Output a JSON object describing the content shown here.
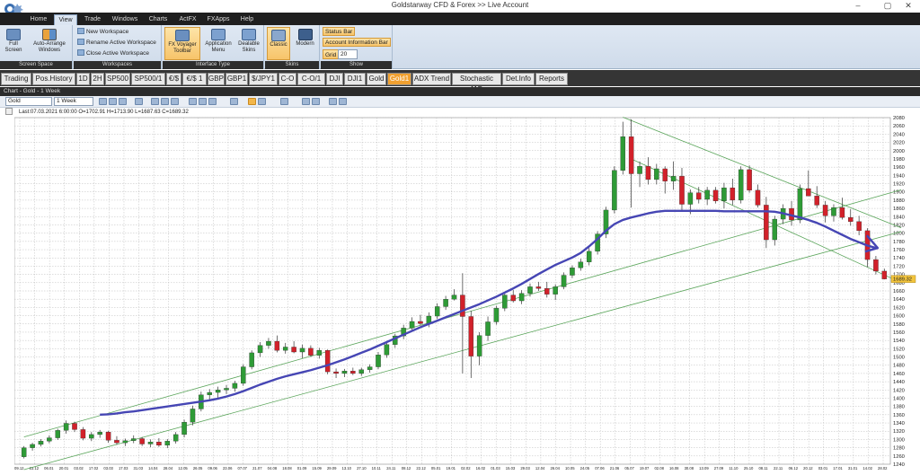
{
  "window": {
    "title": "Goldstarway CFD & Forex  >>  Live Account",
    "min": "–",
    "max": "▢",
    "close": "✕"
  },
  "menu": [
    "Home",
    "View",
    "Trade",
    "Windows",
    "Charts",
    "ActFX",
    "FXApps",
    "Help"
  ],
  "ribbon": {
    "screen_space": {
      "label": "Screen Space",
      "full_screen": "Full Screen",
      "auto_arrange": "Auto-Arrange Windows"
    },
    "workspaces": {
      "label": "Workspaces",
      "new": "New Workspace",
      "rename": "Rename Active Workspace",
      "close": "Close Active Workspace"
    },
    "interface_type": {
      "label": "Interface Type",
      "fxv": "FX Voyager Toolbar",
      "app_menu": "Application Menu",
      "dealable": "Dealable Skins"
    },
    "skins": {
      "label": "Skins",
      "classic": "Classic",
      "modern": "Modern"
    },
    "show": {
      "label": "Show",
      "status_bar": "Status Bar",
      "account_info": "Account Information Bar",
      "grid_label": "Grid",
      "grid_value": "20"
    }
  },
  "symbol_tabs": [
    "Trading",
    "Pos.History",
    "1D",
    "2H",
    "SP500",
    "SP500/1",
    "€/$",
    "€/$ 1",
    "GBP",
    "GBP1",
    "$/JPY1",
    "C-O",
    "C-O/1",
    "DJI",
    "DJI1",
    "Gold",
    "Gold1",
    "ADX Trend",
    "Stochastic 11D",
    "Det.Info",
    "Reports"
  ],
  "active_symbol_tab": "Gold1",
  "chart_window": {
    "title": "Chart - Gold - 1 Week",
    "instrument": "Gold",
    "timeframe": "1 Week",
    "ohlc": "Last:07.03.2021 6:00:00 O=1702.91 H=1713.90 L=1687.63 C=1689.32",
    "price_label": "1689.32"
  },
  "chart_data": {
    "type": "candlestick",
    "ylim": [
      1240,
      2080
    ],
    "y_ticks": [
      2080,
      2060,
      2040,
      2020,
      2000,
      1980,
      1960,
      1940,
      1920,
      1900,
      1880,
      1860,
      1840,
      1820,
      1800,
      1780,
      1760,
      1740,
      1720,
      1700,
      1680,
      1660,
      1640,
      1620,
      1600,
      1580,
      1560,
      1540,
      1520,
      1500,
      1480,
      1460,
      1440,
      1420,
      1400,
      1380,
      1360,
      1340,
      1320,
      1300,
      1280,
      1260,
      1240
    ],
    "x_labels": [
      "09.12",
      "23.12",
      "06.01",
      "20.01",
      "03.02",
      "17.02",
      "03.03",
      "17.03",
      "31.03",
      "14.04",
      "28.04",
      "12.05",
      "26.05",
      "09.06",
      "23.06",
      "07.07",
      "21.07",
      "04.08",
      "18.08",
      "01.09",
      "15.09",
      "29.09",
      "13.10",
      "27.10",
      "10.11",
      "24.11",
      "08.12",
      "22.12",
      "05.01",
      "19.01",
      "02.02",
      "16.02",
      "01.03",
      "15.03",
      "29.03",
      "12.04",
      "26.04",
      "10.05",
      "24.05",
      "07.06",
      "21.06",
      "05.07",
      "19.07",
      "02.08",
      "16.08",
      "30.08",
      "13.09",
      "27.09",
      "11.10",
      "25.10",
      "08.11",
      "22.11",
      "06.12",
      "20.12",
      "03.01",
      "17.01",
      "31.01",
      "14.02",
      "28.02"
    ],
    "candles": [
      [
        1258,
        1284,
        1254,
        1280
      ],
      [
        1280,
        1292,
        1273,
        1288
      ],
      [
        1288,
        1301,
        1283,
        1296
      ],
      [
        1296,
        1310,
        1291,
        1304
      ],
      [
        1304,
        1326,
        1299,
        1322
      ],
      [
        1322,
        1346,
        1314,
        1339
      ],
      [
        1339,
        1343,
        1318,
        1324
      ],
      [
        1324,
        1330,
        1298,
        1303
      ],
      [
        1303,
        1318,
        1296,
        1312
      ],
      [
        1312,
        1323,
        1304,
        1318
      ],
      [
        1318,
        1321,
        1292,
        1298
      ],
      [
        1298,
        1308,
        1287,
        1292
      ],
      [
        1292,
        1302,
        1284,
        1297
      ],
      [
        1297,
        1310,
        1291,
        1302
      ],
      [
        1302,
        1306,
        1284,
        1289
      ],
      [
        1289,
        1300,
        1281,
        1294
      ],
      [
        1294,
        1303,
        1282,
        1286
      ],
      [
        1286,
        1301,
        1279,
        1296
      ],
      [
        1296,
        1318,
        1290,
        1312
      ],
      [
        1312,
        1348,
        1305,
        1342
      ],
      [
        1342,
        1382,
        1334,
        1374
      ],
      [
        1374,
        1416,
        1368,
        1408
      ],
      [
        1408,
        1422,
        1396,
        1414
      ],
      [
        1414,
        1428,
        1401,
        1420
      ],
      [
        1420,
        1432,
        1410,
        1424
      ],
      [
        1424,
        1442,
        1416,
        1436
      ],
      [
        1436,
        1482,
        1430,
        1476
      ],
      [
        1476,
        1516,
        1470,
        1510
      ],
      [
        1510,
        1536,
        1500,
        1528
      ],
      [
        1528,
        1546,
        1520,
        1538
      ],
      [
        1538,
        1552,
        1511,
        1516
      ],
      [
        1516,
        1534,
        1508,
        1524
      ],
      [
        1524,
        1538,
        1509,
        1512
      ],
      [
        1512,
        1530,
        1497,
        1521
      ],
      [
        1521,
        1528,
        1500,
        1504
      ],
      [
        1504,
        1522,
        1496,
        1516
      ],
      [
        1516,
        1518,
        1458,
        1464
      ],
      [
        1464,
        1472,
        1449,
        1460
      ],
      [
        1460,
        1471,
        1451,
        1466
      ],
      [
        1466,
        1474,
        1456,
        1460
      ],
      [
        1460,
        1474,
        1454,
        1469
      ],
      [
        1469,
        1482,
        1462,
        1476
      ],
      [
        1476,
        1512,
        1470,
        1505
      ],
      [
        1505,
        1538,
        1498,
        1530
      ],
      [
        1530,
        1556,
        1522,
        1551
      ],
      [
        1551,
        1578,
        1543,
        1570
      ],
      [
        1570,
        1596,
        1563,
        1586
      ],
      [
        1586,
        1602,
        1577,
        1581
      ],
      [
        1581,
        1608,
        1572,
        1599
      ],
      [
        1599,
        1630,
        1592,
        1622
      ],
      [
        1622,
        1648,
        1614,
        1640
      ],
      [
        1640,
        1664,
        1637,
        1650
      ],
      [
        1650,
        1703,
        1460,
        1598
      ],
      [
        1598,
        1612,
        1449,
        1502
      ],
      [
        1502,
        1560,
        1480,
        1552
      ],
      [
        1552,
        1598,
        1539,
        1585
      ],
      [
        1585,
        1624,
        1578,
        1618
      ],
      [
        1618,
        1656,
        1611,
        1650
      ],
      [
        1650,
        1662,
        1632,
        1636
      ],
      [
        1636,
        1662,
        1628,
        1654
      ],
      [
        1654,
        1678,
        1646,
        1670
      ],
      [
        1670,
        1682,
        1660,
        1666
      ],
      [
        1666,
        1682,
        1644,
        1652
      ],
      [
        1652,
        1676,
        1638,
        1670
      ],
      [
        1670,
        1705,
        1664,
        1698
      ],
      [
        1698,
        1722,
        1691,
        1716
      ],
      [
        1716,
        1738,
        1709,
        1730
      ],
      [
        1730,
        1764,
        1722,
        1756
      ],
      [
        1756,
        1805,
        1748,
        1798
      ],
      [
        1798,
        1864,
        1788,
        1856
      ],
      [
        1856,
        1962,
        1848,
        1952
      ],
      [
        1952,
        2070,
        1942,
        2034
      ],
      [
        2034,
        2076,
        1862,
        1944
      ],
      [
        1944,
        1974,
        1912,
        1962
      ],
      [
        1962,
        1984,
        1918,
        1930
      ],
      [
        1930,
        1968,
        1918,
        1956
      ],
      [
        1956,
        1962,
        1896,
        1926
      ],
      [
        1926,
        1974,
        1905,
        1938
      ],
      [
        1938,
        1958,
        1853,
        1870
      ],
      [
        1870,
        1906,
        1846,
        1898
      ],
      [
        1898,
        1912,
        1872,
        1882
      ],
      [
        1882,
        1912,
        1868,
        1904
      ],
      [
        1904,
        1912,
        1872,
        1878
      ],
      [
        1878,
        1922,
        1860,
        1910
      ],
      [
        1910,
        1932,
        1868,
        1880
      ],
      [
        1880,
        1962,
        1872,
        1954
      ],
      [
        1954,
        1964,
        1898,
        1904
      ],
      [
        1904,
        1918,
        1862,
        1868
      ],
      [
        1868,
        1888,
        1764,
        1784
      ],
      [
        1784,
        1842,
        1770,
        1834
      ],
      [
        1834,
        1870,
        1822,
        1860
      ],
      [
        1860,
        1878,
        1818,
        1832
      ],
      [
        1832,
        1918,
        1824,
        1908
      ],
      [
        1908,
        1952,
        1898,
        1890
      ],
      [
        1890,
        1914,
        1861,
        1868
      ],
      [
        1868,
        1878,
        1826,
        1842
      ],
      [
        1842,
        1870,
        1828,
        1862
      ],
      [
        1862,
        1886,
        1833,
        1838
      ],
      [
        1838,
        1858,
        1818,
        1828
      ],
      [
        1828,
        1842,
        1795,
        1806
      ],
      [
        1806,
        1812,
        1718,
        1736
      ],
      [
        1736,
        1745,
        1700,
        1708
      ],
      [
        1708,
        1714,
        1688,
        1689
      ]
    ],
    "moving_average": [
      [
        9,
        1360
      ],
      [
        10,
        1361
      ],
      [
        11,
        1363
      ],
      [
        12,
        1366
      ],
      [
        13,
        1368
      ],
      [
        14,
        1371
      ],
      [
        15,
        1374
      ],
      [
        16,
        1377
      ],
      [
        17,
        1380
      ],
      [
        18,
        1383
      ],
      [
        19,
        1386
      ],
      [
        20,
        1389
      ],
      [
        21,
        1392
      ],
      [
        22,
        1395
      ],
      [
        23,
        1399
      ],
      [
        24,
        1404
      ],
      [
        25,
        1410
      ],
      [
        26,
        1417
      ],
      [
        27,
        1425
      ],
      [
        28,
        1433
      ],
      [
        29,
        1440
      ],
      [
        30,
        1447
      ],
      [
        31,
        1453
      ],
      [
        32,
        1458
      ],
      [
        33,
        1463
      ],
      [
        34,
        1468
      ],
      [
        35,
        1474
      ],
      [
        36,
        1480
      ],
      [
        37,
        1487
      ],
      [
        38,
        1494
      ],
      [
        39,
        1502
      ],
      [
        40,
        1510
      ],
      [
        41,
        1518
      ],
      [
        42,
        1527
      ],
      [
        43,
        1536
      ],
      [
        44,
        1545
      ],
      [
        45,
        1554
      ],
      [
        46,
        1563
      ],
      [
        47,
        1572
      ],
      [
        48,
        1580
      ],
      [
        49,
        1588
      ],
      [
        50,
        1596
      ],
      [
        51,
        1604
      ],
      [
        52,
        1612
      ],
      [
        53,
        1620
      ],
      [
        54,
        1628
      ],
      [
        55,
        1637
      ],
      [
        56,
        1646
      ],
      [
        57,
        1656
      ],
      [
        58,
        1666
      ],
      [
        59,
        1677
      ],
      [
        60,
        1689
      ],
      [
        61,
        1701
      ],
      [
        62,
        1712
      ],
      [
        63,
        1723
      ],
      [
        64,
        1732
      ],
      [
        65,
        1741
      ],
      [
        66,
        1752
      ],
      [
        67,
        1768
      ],
      [
        68,
        1786
      ],
      [
        69,
        1806
      ],
      [
        70,
        1822
      ],
      [
        71,
        1832
      ],
      [
        72,
        1838
      ],
      [
        73,
        1843
      ],
      [
        74,
        1848
      ],
      [
        75,
        1852
      ],
      [
        76,
        1854
      ],
      [
        77,
        1854
      ],
      [
        78,
        1854
      ],
      [
        79,
        1854
      ],
      [
        80,
        1854
      ],
      [
        81,
        1854
      ],
      [
        82,
        1854
      ],
      [
        83,
        1853
      ],
      [
        84,
        1853
      ],
      [
        85,
        1853
      ],
      [
        86,
        1853
      ],
      [
        87,
        1853
      ],
      [
        88,
        1853
      ],
      [
        89,
        1852
      ],
      [
        90,
        1848
      ],
      [
        91,
        1843
      ],
      [
        92,
        1838
      ],
      [
        93,
        1832
      ],
      [
        94,
        1825
      ],
      [
        95,
        1816
      ],
      [
        96,
        1806
      ],
      [
        97,
        1796
      ],
      [
        98,
        1786
      ],
      [
        99,
        1778
      ],
      [
        100,
        1770
      ],
      [
        101,
        1764
      ]
    ],
    "channel_lines": [
      [
        [
          0,
          1306
        ],
        [
          104,
          1905
        ]
      ],
      [
        [
          0,
          1227
        ],
        [
          104,
          1804
        ]
      ],
      [
        [
          71,
          2081
        ],
        [
          104,
          1813
        ]
      ],
      [
        [
          72,
          1980
        ],
        [
          104,
          1680
        ]
      ]
    ]
  },
  "colors": {
    "up": "#2e9b36",
    "down": "#d2212a",
    "ma": "#4646b4",
    "channel": "#5aa55a",
    "grid": "#bcbcbc",
    "price_label": "#f2c43d"
  }
}
